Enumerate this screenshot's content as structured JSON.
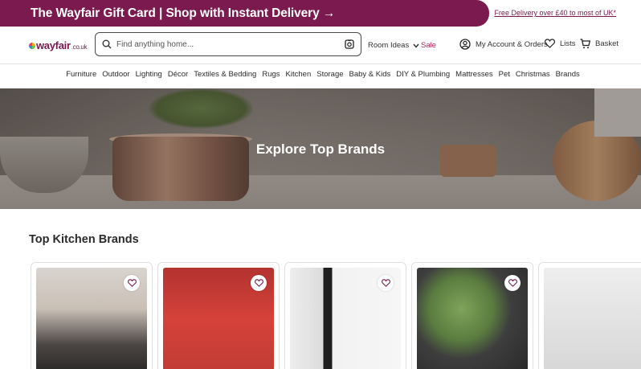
{
  "promo": {
    "text": "The Wayfair Gift Card | Shop with Instant Delivery →",
    "side_link": "Free Delivery over £40 to most of UK*"
  },
  "header": {
    "logo": "wayfair",
    "logo_tld": ".co.uk",
    "search_placeholder": "Find anything home...",
    "room_ideas": "Room Ideas",
    "sale": "Sale",
    "account": "My Account & Orders",
    "lists": "Lists",
    "basket": "Basket"
  },
  "categories": [
    "Furniture",
    "Outdoor",
    "Lighting",
    "Décor",
    "Textiles & Bedding",
    "Rugs",
    "Kitchen",
    "Storage",
    "Baby & Kids",
    "DIY & Plumbing",
    "Mattresses",
    "Pet",
    "Christmas",
    "Brands"
  ],
  "hero": {
    "title": "Explore Top Brands"
  },
  "section": {
    "title": "Top Kitchen Brands"
  },
  "colors": {
    "brand": "#7b1a4f",
    "sale": "#b81c50"
  }
}
